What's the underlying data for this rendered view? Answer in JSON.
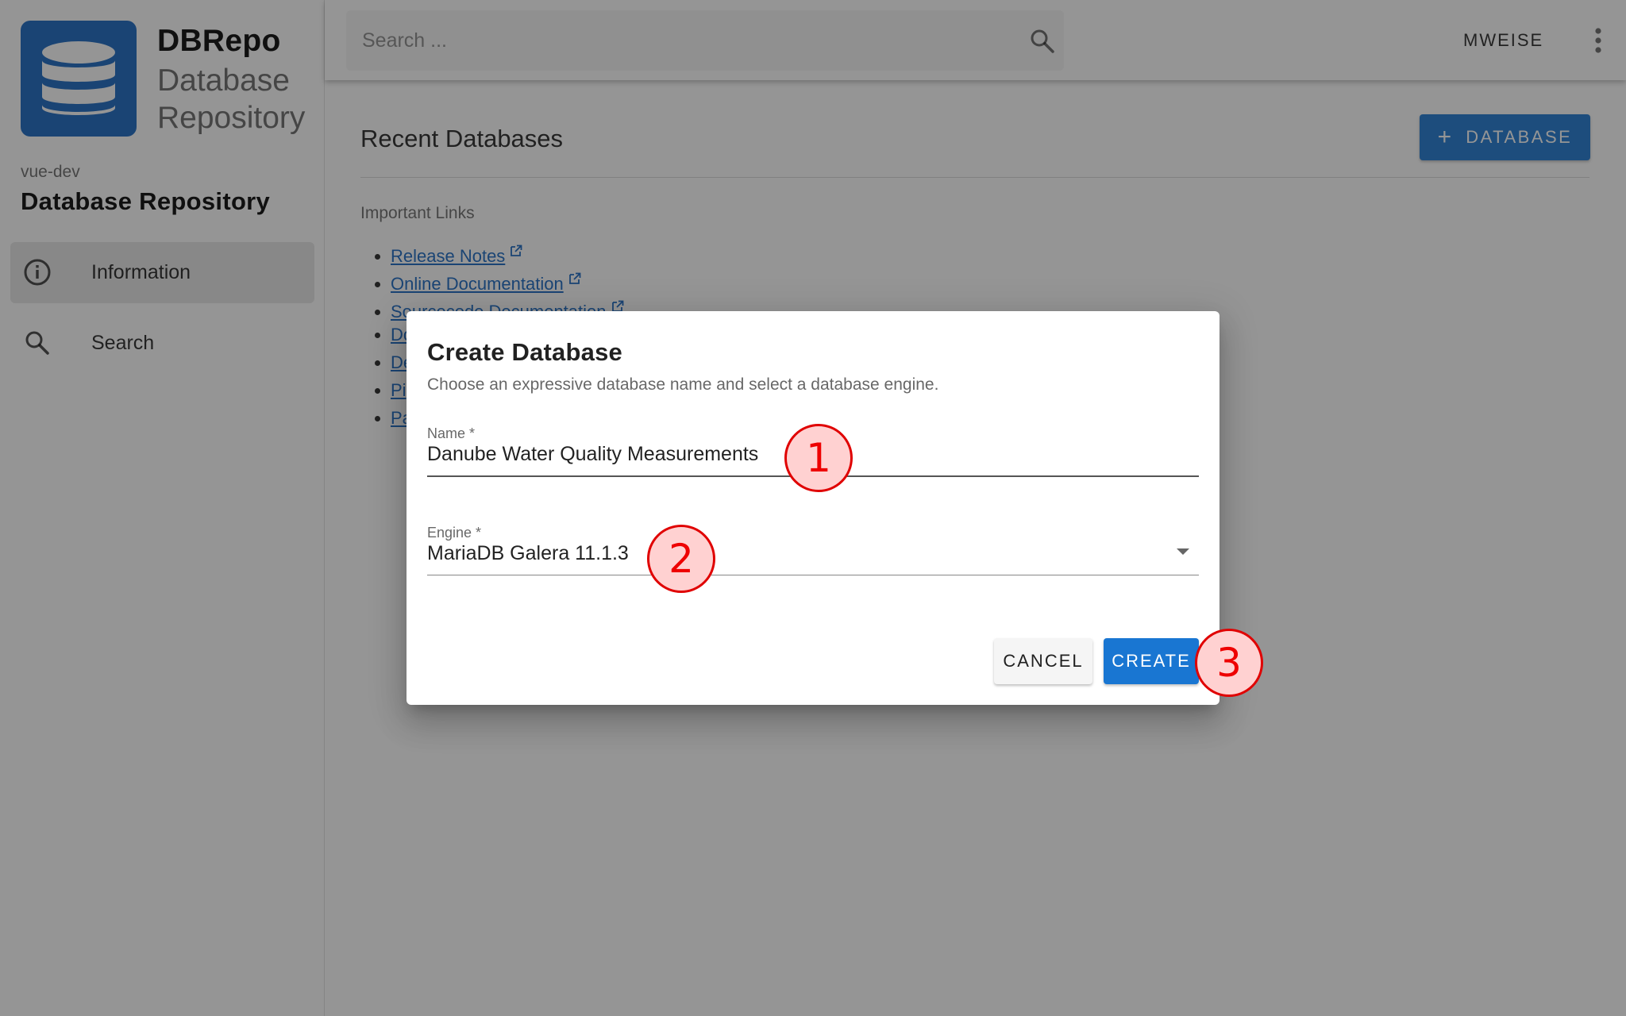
{
  "brand": {
    "title": "DBRepo",
    "subtitle_line1": "Database",
    "subtitle_line2": "Repository",
    "logo_icon": "database-icon",
    "logo_color": "#1565c0"
  },
  "sidebar": {
    "instance": "vue-dev",
    "repo_name": "Database Repository",
    "items": [
      {
        "label": "Information",
        "icon": "info-icon",
        "active": true
      },
      {
        "label": "Search",
        "icon": "search-icon",
        "active": false
      }
    ]
  },
  "header": {
    "search_placeholder": "Search ...",
    "user": "MWEISE"
  },
  "main": {
    "title": "Recent Databases",
    "add_button": "DATABASE",
    "links_heading": "Important Links",
    "links": [
      "Release Notes",
      "Online Documentation",
      "Sourcecode Documentation",
      "Do",
      "De",
      "Pi",
      "Pa"
    ]
  },
  "dialog": {
    "title": "Create Database",
    "subtitle": "Choose an expressive database name and select a database engine.",
    "name_label": "Name *",
    "name_value": "Danube Water Quality Measurements",
    "engine_label": "Engine *",
    "engine_value": "MariaDB Galera 11.1.3",
    "cancel": "CANCEL",
    "create": "CREATE"
  },
  "markers": [
    "1",
    "2",
    "3"
  ],
  "colors": {
    "primary": "#1976d2",
    "marker_fill": "#ffd1d1",
    "marker_stroke": "#e00000"
  }
}
